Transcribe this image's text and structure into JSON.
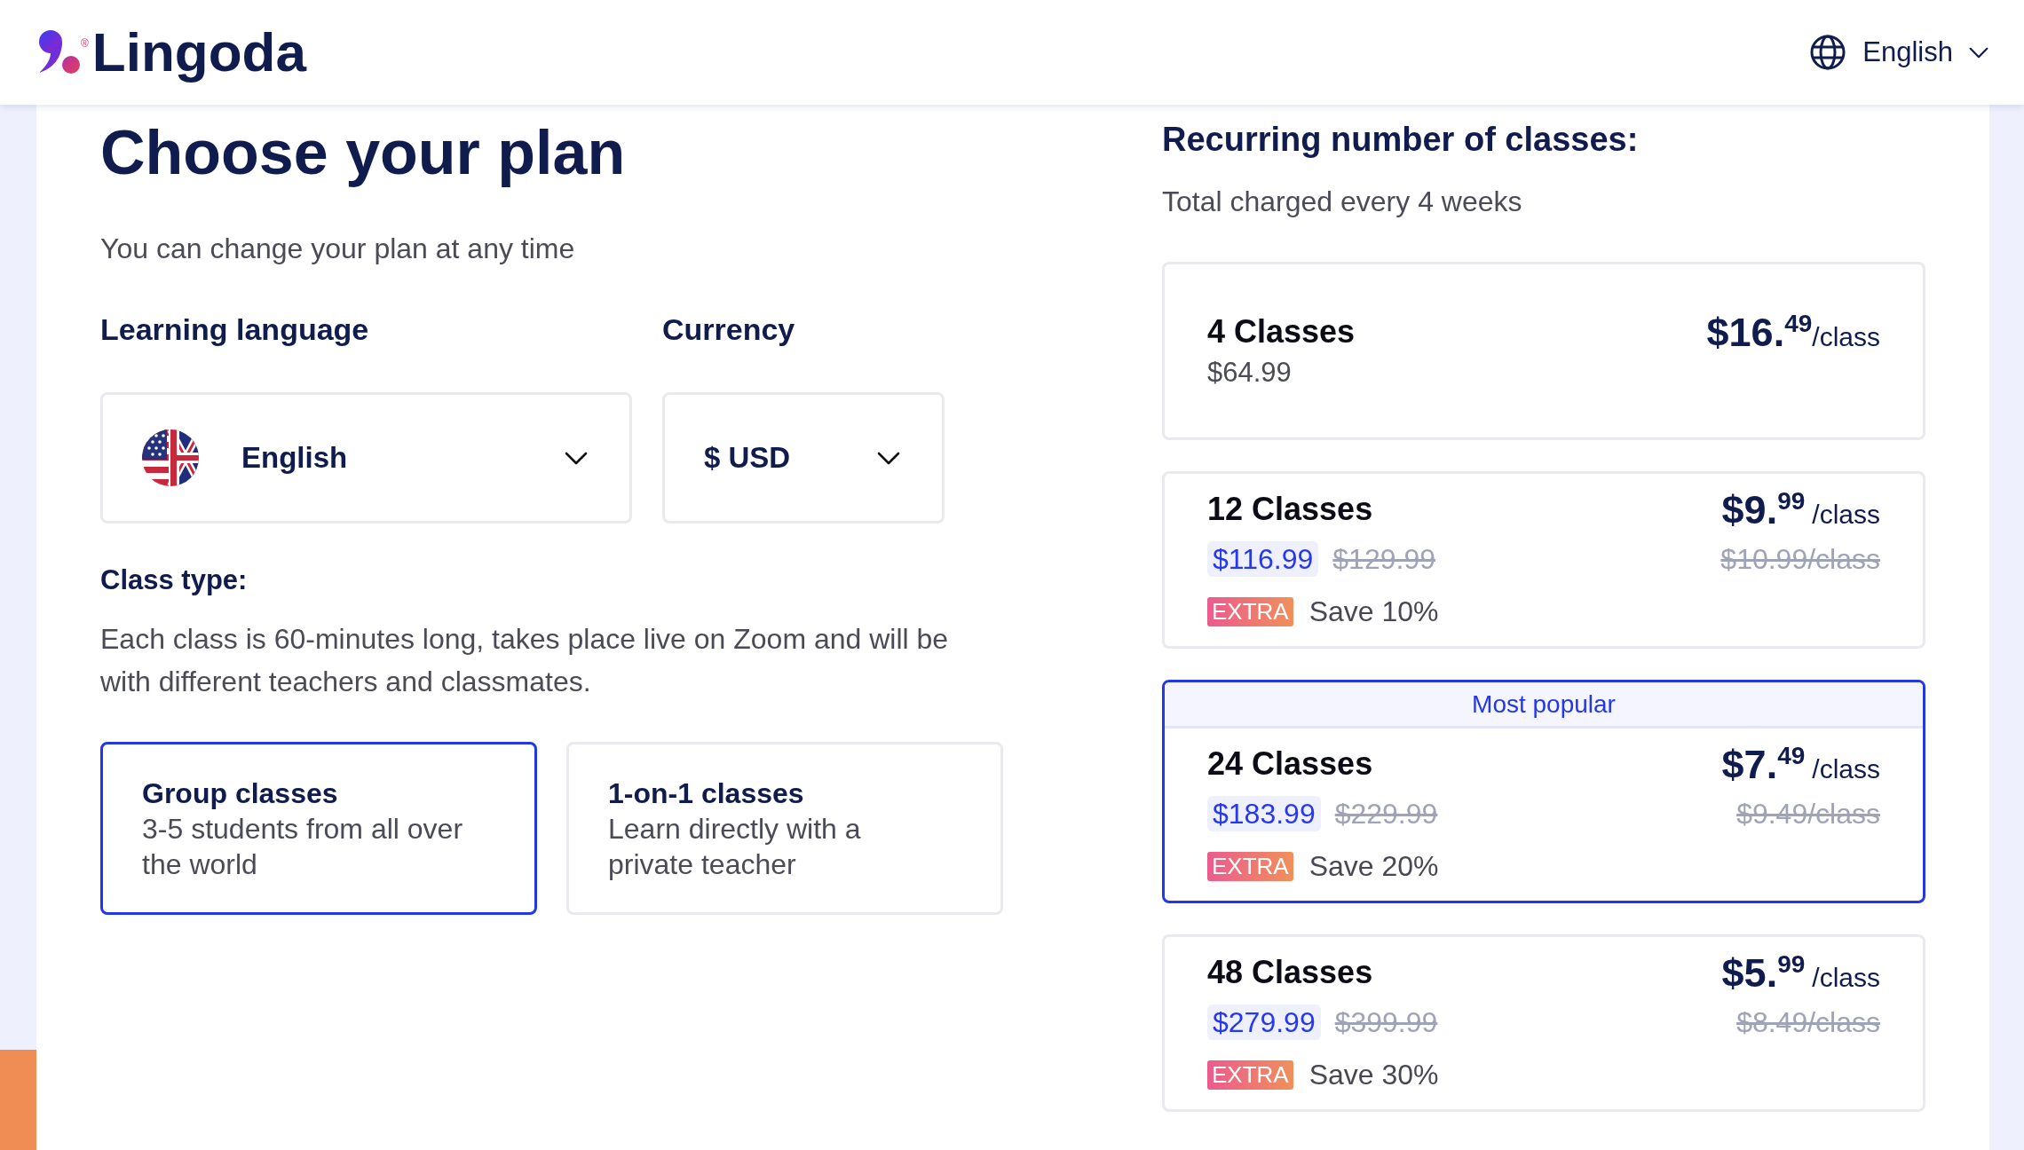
{
  "header": {
    "logo": {
      "text": "Lingoda",
      "registered_mark": "®"
    },
    "language_selector": {
      "label": "English"
    }
  },
  "plan_setup": {
    "title": "Choose your plan",
    "subtitle": "You can change your plan at any time",
    "learning_language": {
      "label": "Learning language",
      "value": "English"
    },
    "currency": {
      "label": "Currency",
      "value": "$ USD"
    },
    "class_type": {
      "label": "Class type:",
      "description": "Each class is 60-minutes long, takes place live on Zoom and will be with different teachers and classmates.",
      "options": [
        {
          "title": "Group classes",
          "description": "3-5 students from all over the world",
          "selected": true
        },
        {
          "title": "1-on-1 classes",
          "description": "Learn directly with a private teacher",
          "selected": false
        }
      ]
    }
  },
  "plans": {
    "title": "Recurring number of classes:",
    "subtitle": "Total charged every 4 weeks",
    "items": [
      {
        "kind": "regular",
        "name": "4 Classes",
        "total": "$64.99",
        "price": {
          "whole": "$16.",
          "cents": "49",
          "unit": "/class"
        },
        "selected": false
      },
      {
        "kind": "discounted",
        "name": "12 Classes",
        "total": "$116.99",
        "original_total": "$129.99",
        "price": {
          "whole": "$9.",
          "cents": "99",
          "unit": "/class"
        },
        "original_price": "$10.99/class",
        "badge": "EXTRA",
        "saving": "Save 10%",
        "selected": false
      },
      {
        "kind": "discounted",
        "banner": "Most popular",
        "name": "24 Classes",
        "total": "$183.99",
        "original_total": "$229.99",
        "price": {
          "whole": "$7.",
          "cents": "49",
          "unit": "/class"
        },
        "original_price": "$9.49/class",
        "badge": "EXTRA",
        "saving": "Save 20%",
        "selected": true
      },
      {
        "kind": "discounted",
        "name": "48 Classes",
        "total": "$279.99",
        "original_total": "$399.99",
        "price": {
          "whole": "$5.",
          "cents": "99",
          "unit": "/class"
        },
        "original_price": "$8.49/class",
        "badge": "EXTRA",
        "saving": "Save 30%",
        "selected": false
      }
    ]
  }
}
